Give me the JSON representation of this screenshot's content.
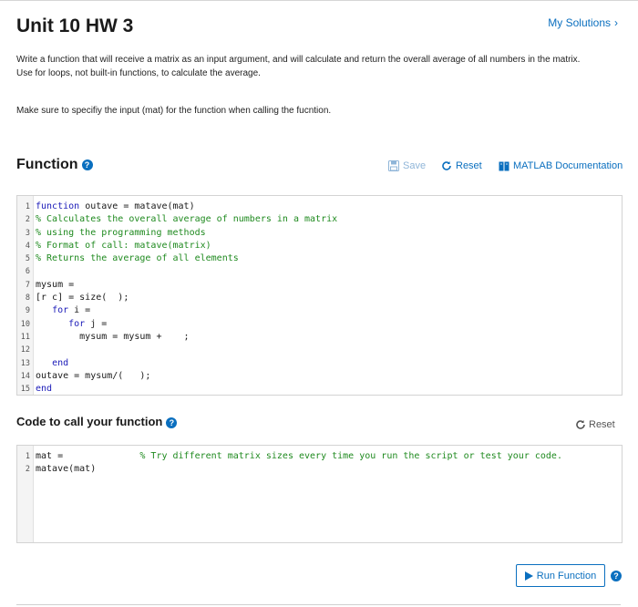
{
  "header": {
    "title": "Unit 10 HW 3",
    "my_solutions": "My Solutions",
    "chevron": "›"
  },
  "description": {
    "line1": "Write a function that will receive a matrix as an input argument, and will calculate and return the overall average of all numbers in the matrix.",
    "line2": "Use for loops, not built-in functions, to calculate the average.",
    "note": "Make sure to specifiy the input (mat) for the function when calling the fucntion."
  },
  "function_section": {
    "title": "Function",
    "help": "?",
    "save_label": "Save",
    "reset_label": "Reset",
    "doc_label": "MATLAB Documentation",
    "lines": [
      {
        "n": "1",
        "segments": [
          {
            "t": "function",
            "c": "kw"
          },
          {
            "t": " outave = matave(mat)",
            "c": ""
          }
        ]
      },
      {
        "n": "2",
        "segments": [
          {
            "t": "% Calculates the overall average of numbers in a matrix",
            "c": "cm"
          }
        ]
      },
      {
        "n": "3",
        "segments": [
          {
            "t": "% using the programming methods",
            "c": "cm"
          }
        ]
      },
      {
        "n": "4",
        "segments": [
          {
            "t": "% Format of call: matave(matrix)",
            "c": "cm"
          }
        ]
      },
      {
        "n": "5",
        "segments": [
          {
            "t": "% Returns the average of all elements",
            "c": "cm"
          }
        ]
      },
      {
        "n": "6",
        "segments": [
          {
            "t": "",
            "c": ""
          }
        ]
      },
      {
        "n": "7",
        "segments": [
          {
            "t": "mysum =",
            "c": ""
          }
        ]
      },
      {
        "n": "8",
        "segments": [
          {
            "t": "[r c] = size(  );",
            "c": ""
          }
        ]
      },
      {
        "n": "9",
        "segments": [
          {
            "t": "   ",
            "c": ""
          },
          {
            "t": "for",
            "c": "kw"
          },
          {
            "t": " i =",
            "c": ""
          }
        ]
      },
      {
        "n": "10",
        "segments": [
          {
            "t": "      ",
            "c": ""
          },
          {
            "t": "for",
            "c": "kw"
          },
          {
            "t": " j =",
            "c": ""
          }
        ]
      },
      {
        "n": "11",
        "segments": [
          {
            "t": "        mysum = mysum +    ;",
            "c": ""
          }
        ]
      },
      {
        "n": "12",
        "segments": [
          {
            "t": "",
            "c": ""
          }
        ]
      },
      {
        "n": "13",
        "segments": [
          {
            "t": "   ",
            "c": ""
          },
          {
            "t": "end",
            "c": "kw"
          }
        ]
      },
      {
        "n": "14",
        "segments": [
          {
            "t": "outave = mysum/(   );",
            "c": ""
          }
        ]
      },
      {
        "n": "15",
        "segments": [
          {
            "t": "end",
            "c": "kw"
          }
        ]
      }
    ]
  },
  "call_section": {
    "title": "Code to call your function",
    "help": "?",
    "reset_label": "Reset",
    "lines": [
      {
        "n": "1",
        "segments": [
          {
            "t": "mat =              ",
            "c": ""
          },
          {
            "t": "% Try different matrix sizes every time you run the script or test your code.",
            "c": "cm"
          }
        ]
      },
      {
        "n": "2",
        "segments": [
          {
            "t": "matave(mat)",
            "c": ""
          }
        ]
      }
    ]
  },
  "run": {
    "label": "Run Function",
    "help": "?"
  },
  "colors": {
    "accent": "#0a6fbf",
    "keyword": "#1a1ab8",
    "comment": "#1f8a1f"
  }
}
